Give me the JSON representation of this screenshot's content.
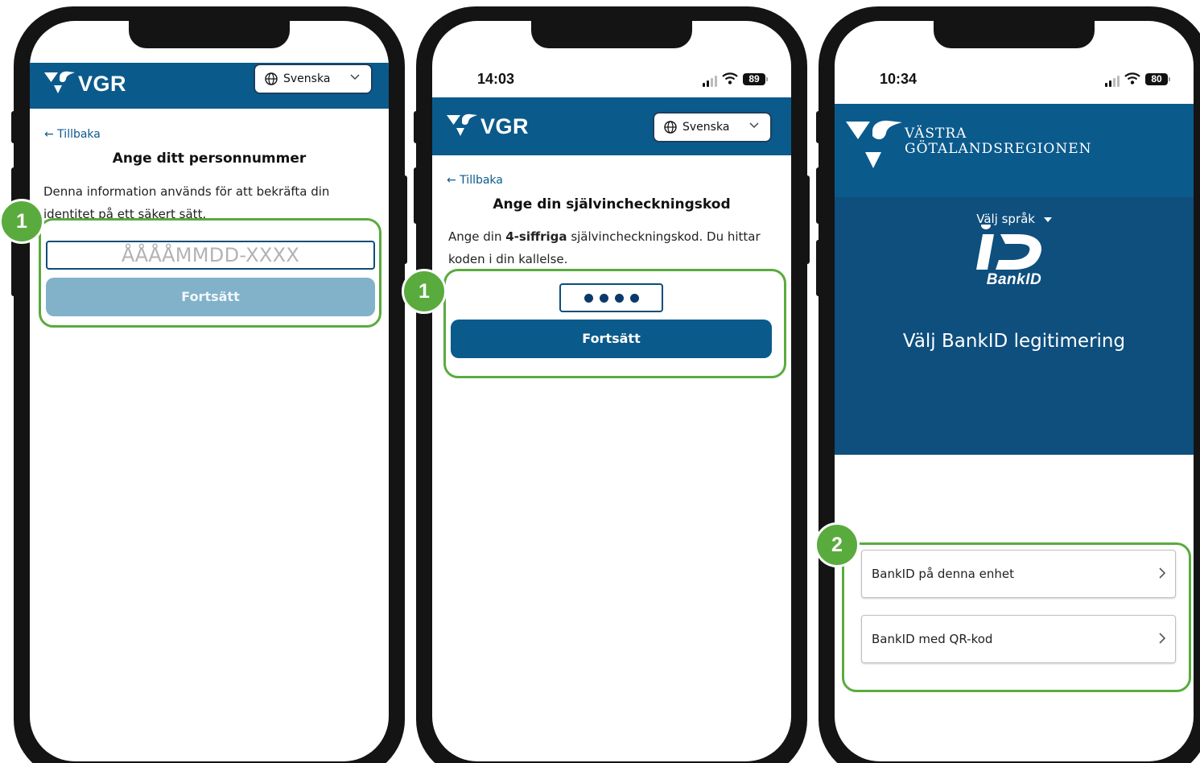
{
  "phone1": {
    "header": {
      "logo_text": "VGR",
      "language": "Svenska"
    },
    "back_label": "← Tillbaka",
    "title": "Ange ditt personnummer",
    "description": "Denna information används för att bekräfta din identitet på ett säkert sätt.",
    "input_placeholder": "ÅÅÅÅMMDD-XXXX",
    "continue_label": "Fortsätt",
    "marker": "1"
  },
  "phone2": {
    "status": {
      "time": "14:03",
      "battery": "89"
    },
    "header": {
      "logo_text": "VGR",
      "language": "Svenska"
    },
    "back_label": "← Tillbaka",
    "title": "Ange din självincheckningskod",
    "description_pre": "Ange din ",
    "description_bold": "4-siffriga",
    "description_post": " självincheckningskod. Du hittar koden i din kallelse.",
    "continue_label": "Fortsätt",
    "marker": "1"
  },
  "phone3": {
    "status": {
      "time": "10:34",
      "battery": "80"
    },
    "region_line1": "VÄSTRA",
    "region_line2": "GÖTALANDSREGIONEN",
    "language_link": "Välj språk",
    "bankid_label": "BankID",
    "title": "Välj BankID legitimering",
    "options": [
      "BankID på denna enhet",
      "BankID med QR-kod"
    ],
    "marker": "2"
  },
  "colors": {
    "brand_blue": "#0b5a8c",
    "highlight_green": "#5aab3e",
    "disabled_button": "#82b1ca"
  }
}
